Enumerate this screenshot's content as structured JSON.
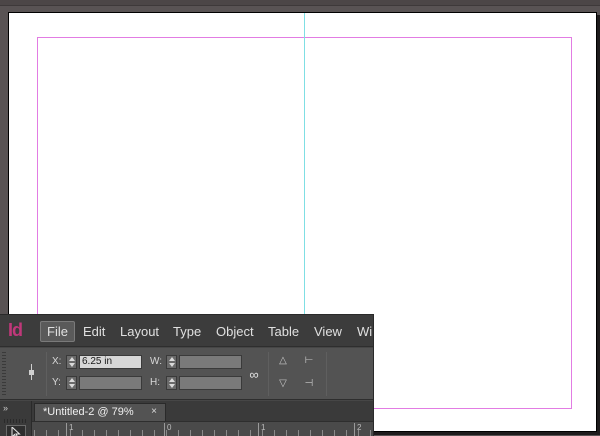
{
  "app": {
    "logo": "Id",
    "menu": [
      "File",
      "Edit",
      "Layout",
      "Type",
      "Object",
      "Table",
      "View",
      "Win"
    ],
    "active_menu_index": 0
  },
  "control_panel": {
    "x_label": "X:",
    "x_value": "6.25 in",
    "y_label": "Y:",
    "y_value": "",
    "w_label": "W:",
    "w_value": "",
    "h_label": "H:",
    "h_value": ""
  },
  "document_tab": {
    "label": "*Untitled-2 @ 79%",
    "close": "×"
  },
  "ruler": {
    "labels": [
      "1",
      "0",
      "1",
      "2"
    ]
  },
  "tools": {
    "collapse": "»"
  },
  "colors": {
    "pasteboard": "#595354",
    "margin_guide": "#e27ce3",
    "column_guide": "#7fdfe4",
    "logo": "#c0387a"
  }
}
